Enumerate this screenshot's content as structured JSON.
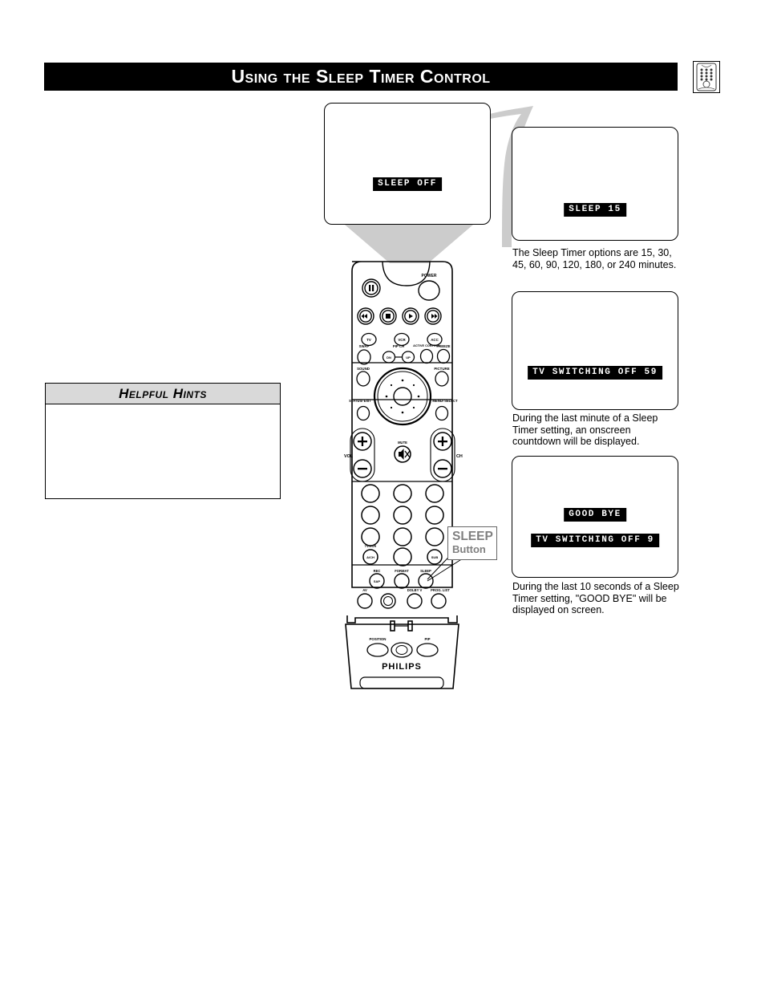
{
  "page": {
    "title": "Using the Sleep Timer Control",
    "header_icon": "remote-control-icon"
  },
  "tv_screens": [
    {
      "id": "tv-screen-1",
      "osd_messages": [
        "SLEEP OFF"
      ],
      "caption": ""
    },
    {
      "id": "tv-screen-2",
      "osd_messages": [
        "SLEEP 15"
      ],
      "caption": "The Sleep Timer options are 15, 30, 45, 60, 90, 120, 180, or 240 minutes."
    },
    {
      "id": "tv-screen-3",
      "osd_messages": [
        "TV SWITCHING OFF 59"
      ],
      "caption": "During the last minute of a Sleep Timer setting, an onscreen countdown will be displayed."
    },
    {
      "id": "tv-screen-4",
      "osd_messages": [
        "GOOD BYE",
        "TV SWITCHING OFF 9"
      ],
      "caption": "During the last 10 seconds of a Sleep Timer setting, \"GOOD BYE\" will be displayed on screen."
    }
  ],
  "osd": {
    "sleep_off": "SLEEP OFF",
    "sleep_15": "SLEEP 15",
    "tv_switching_off_59": "TV SWITCHING OFF 59",
    "good_bye": "GOOD BYE",
    "tv_switching_off_9": "TV SWITCHING OFF 9"
  },
  "captions": {
    "one": "The Sleep Timer options are 15, 30, 45, 60, 90, 120, 180, or 240 minutes.",
    "two": "During the last minute of a Sleep Timer setting, an onscreen countdown will be displayed.",
    "three": "During the last 10 seconds of a Sleep Timer setting, \"GOOD BYE\" will be displayed on screen."
  },
  "helpful_hints": {
    "title": "Helpful Hints",
    "body": ""
  },
  "callout": {
    "line1": "SLEEP",
    "line2": "Button",
    "color": "#808080"
  },
  "remote": {
    "brand": "PHILIPS",
    "labels": {
      "power": "POWER",
      "tv": "TV",
      "vcr": "VCR",
      "acc": "ACC",
      "swap": "SWAP",
      "pip_ch": "PIP CH",
      "pip_ch_dn": "DN",
      "pip_ch_up": "UP",
      "active_control": "ACTIVE CONTROL",
      "freeze": "FREEZE",
      "sound": "SOUND",
      "picture": "PICTURE",
      "status_exit": "STATUS/ EXIT",
      "menu_select": "MENU/ SELECT",
      "vol": "VOL",
      "ch": "CH",
      "mute": "MUTE",
      "tv_vcr": "TV/VCR",
      "a_ch": "A/CH",
      "sub": "SUB",
      "rec": "REC",
      "sap": "SAP",
      "format": "FORMAT",
      "sleep": "SLEEP",
      "av": "AV",
      "dolby_v": "DOLBY V",
      "prog_list": "PROG. LIST",
      "position": "POSITION",
      "pip": "PIP"
    }
  },
  "colors": {
    "title_bar_bg": "#000000",
    "title_bar_fg": "#ffffff",
    "hints_header_bg": "#d9d9d9",
    "decor_gray": "#cccccc",
    "callout_gray": "#808080",
    "osd_bg": "#000000",
    "osd_fg": "#ffffff"
  }
}
